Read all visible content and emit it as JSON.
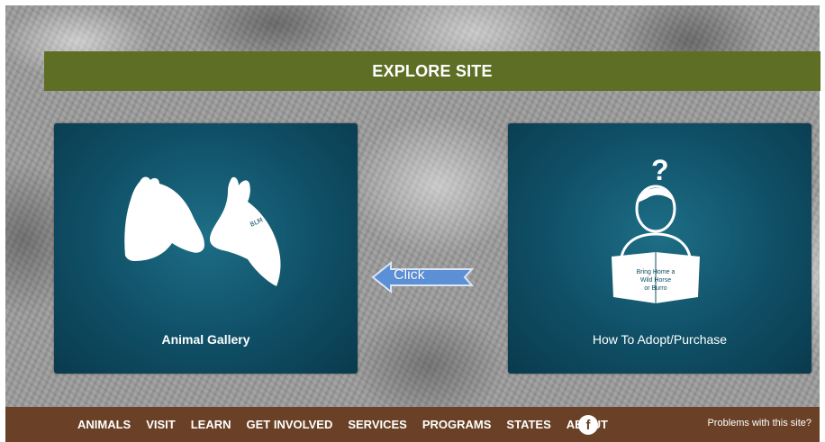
{
  "explore": {
    "title": "EXPLORE SITE"
  },
  "cards": [
    {
      "label": "Animal Gallery",
      "icon": "horse-burro-heads-icon"
    },
    {
      "label": "How To Adopt/Purchase",
      "icon": "person-reading-question-icon",
      "sign_lines": [
        "Bring Home a",
        "Wild Horse",
        "or Burro"
      ],
      "question_mark": "?"
    }
  ],
  "annotation": {
    "text": "Click"
  },
  "footer": {
    "nav": [
      "ANIMALS",
      "VISIT",
      "LEARN",
      "GET INVOLVED",
      "SERVICES",
      "PROGRAMS",
      "STATES",
      "ABOUT"
    ],
    "facebook_glyph": "f",
    "problems": "Problems with this site?"
  },
  "colors": {
    "explore_bar": "#5f6e25",
    "card_bg": "#0f4f66",
    "footer_bg": "#6a4127",
    "arrow": "#5b8fd6"
  }
}
